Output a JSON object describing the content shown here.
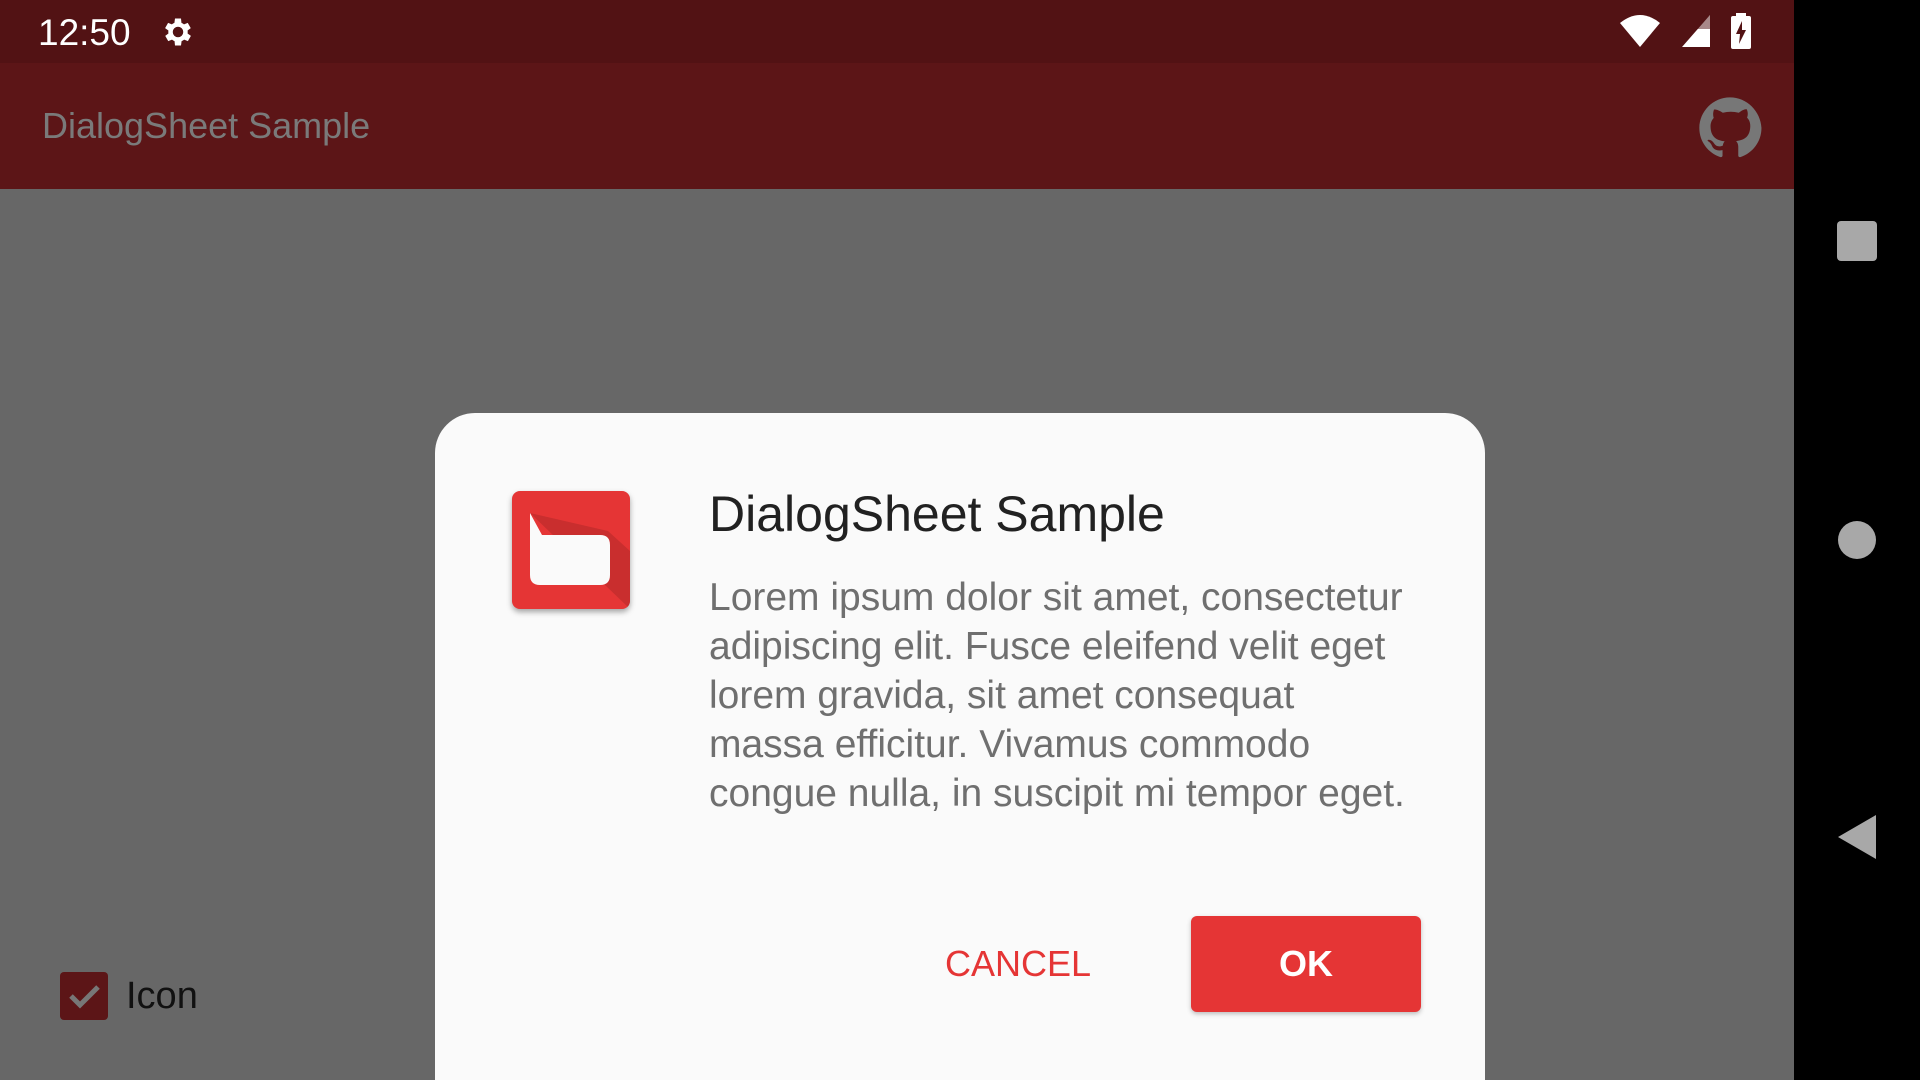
{
  "status_bar": {
    "time": "12:50",
    "icons": [
      "gear-icon",
      "wifi-icon",
      "signal-icon",
      "battery-charging-icon"
    ]
  },
  "app_bar": {
    "title": "DialogSheet Sample",
    "action_icon": "github-icon"
  },
  "options": {
    "icon_checkbox": {
      "label": "Icon",
      "checked": true
    }
  },
  "dialog": {
    "icon": "dialog-app-icon",
    "title": "DialogSheet Sample",
    "message": "Lorem ipsum dolor sit amet, consectetur adipiscing elit. Fusce eleifend velit eget lorem gravida, sit amet consequat massa efficitur. Vivamus commodo congue nulla, in suscipit mi tempor eget.",
    "negative_button": "CANCEL",
    "positive_button": "OK"
  },
  "nav_bar": {
    "buttons": [
      "recents-icon",
      "home-icon",
      "back-icon"
    ]
  },
  "colors": {
    "accent": "#e53535",
    "app_bar": "#5c1517",
    "status_bar": "#521214",
    "scrim_background": "#676767",
    "dialog_background": "#fafafa"
  }
}
